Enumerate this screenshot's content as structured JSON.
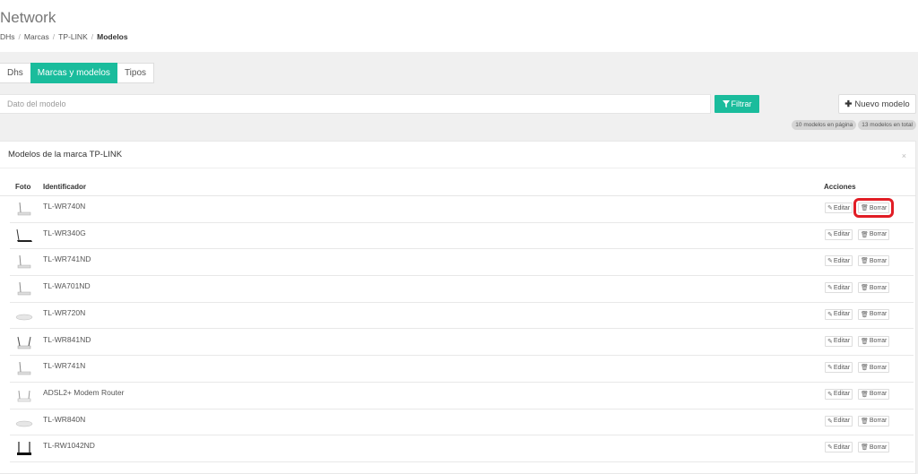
{
  "header": {
    "title": "Network",
    "breadcrumb": [
      "DHs",
      "Marcas",
      "TP-LINK",
      "Modelos"
    ]
  },
  "tabs": [
    {
      "label": "Dhs",
      "active": false
    },
    {
      "label": "Marcas y modelos",
      "active": true
    },
    {
      "label": "Tipos",
      "active": false
    }
  ],
  "search": {
    "placeholder": "Dato del modelo",
    "value": ""
  },
  "filter_button": {
    "label": "Filtrar",
    "icon": "filter-icon"
  },
  "new_button": {
    "label": "Nuevo modelo",
    "icon": "plus-icon"
  },
  "counts": {
    "per_page": "10 modelos en página",
    "total": "13 modelos en total"
  },
  "panel": {
    "title": "Modelos de la marca TP-LINK",
    "close": "×"
  },
  "table": {
    "columns": [
      "Foto",
      "Identificador",
      "Acciones"
    ],
    "edit_label": "Editar",
    "delete_label": "Borrar",
    "rows": [
      {
        "identifier": "TL-WR740N",
        "photo": "router-single-antenna"
      },
      {
        "identifier": "TL-WR340G",
        "photo": "router-black"
      },
      {
        "identifier": "TL-WR741ND",
        "photo": "router-single-antenna"
      },
      {
        "identifier": "TL-WA701ND",
        "photo": "router-single-antenna"
      },
      {
        "identifier": "TL-WR720N",
        "photo": "router-flat"
      },
      {
        "identifier": "TL-WR841ND",
        "photo": "router-dual-antenna"
      },
      {
        "identifier": "TL-WR741N",
        "photo": "router-single-antenna"
      },
      {
        "identifier": "ADSL2+ Modem Router",
        "photo": "router-dual-antenna-white"
      },
      {
        "identifier": "TL-WR840N",
        "photo": "router-flat"
      },
      {
        "identifier": "TL-RW1042ND",
        "photo": "router-black-dual"
      }
    ]
  },
  "colors": {
    "accent": "#1abc9c",
    "highlight": "#e11d25"
  }
}
